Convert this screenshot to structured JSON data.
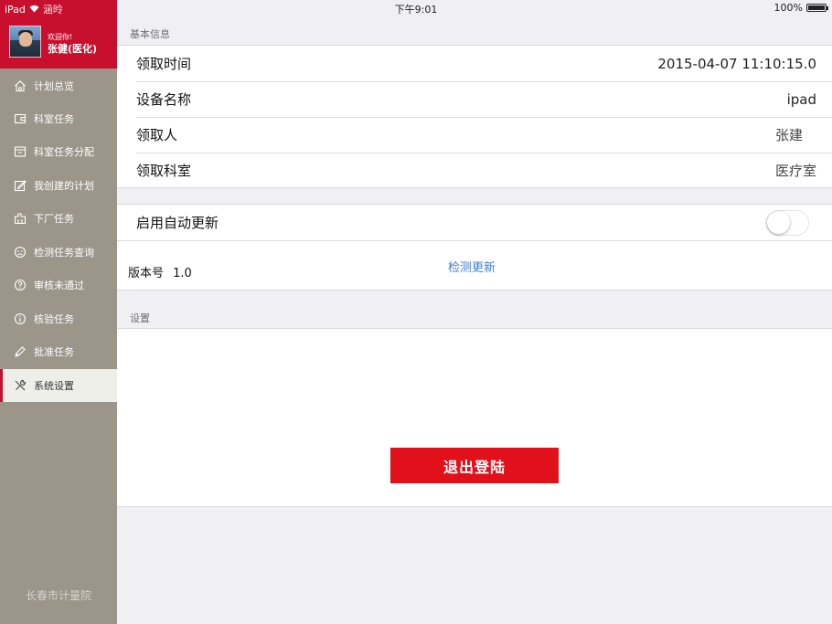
{
  "status_bar": {
    "device": "iPad",
    "carrier": "涵昤",
    "time": "下午9:01",
    "battery": "100%"
  },
  "sidebar": {
    "welcome": "欢迎你!",
    "username": "张健(医化)",
    "items": [
      {
        "label": "计划总览",
        "icon": "home-icon"
      },
      {
        "label": "科室任务",
        "icon": "wallet-icon"
      },
      {
        "label": "科室任务分配",
        "icon": "tray-icon"
      },
      {
        "label": "我创建的计划",
        "icon": "edit-icon"
      },
      {
        "label": "下厂任务",
        "icon": "factory-icon"
      },
      {
        "label": "检测任务查询",
        "icon": "face-icon"
      },
      {
        "label": "审核未通过",
        "icon": "question-icon"
      },
      {
        "label": "核验任务",
        "icon": "info-icon"
      },
      {
        "label": "批准任务",
        "icon": "pen-icon"
      },
      {
        "label": "系统设置",
        "icon": "tools-icon",
        "active": true
      }
    ],
    "footer": "长春市计量院"
  },
  "main": {
    "basic_info_header": "基本信息",
    "basic_info": [
      {
        "label": "领取时间",
        "value": "2015-04-07 11:10:15.0"
      },
      {
        "label": "设备名称",
        "value": "ipad"
      },
      {
        "label": "领取人",
        "value": "张建"
      },
      {
        "label": "领取科室",
        "value": "医疗室"
      }
    ],
    "auto_update_label": "启用自动更新",
    "auto_update_enabled": false,
    "version_label": "版本号",
    "version_value": "1.0",
    "check_update": "检测更新",
    "settings_header": "设置",
    "logout_label": "退出登陆"
  },
  "colors": {
    "brand_red": "#c8102e",
    "logout_red": "#e2101a",
    "sidebar_bg": "#9c968a",
    "link_blue": "#3b7fd8"
  }
}
